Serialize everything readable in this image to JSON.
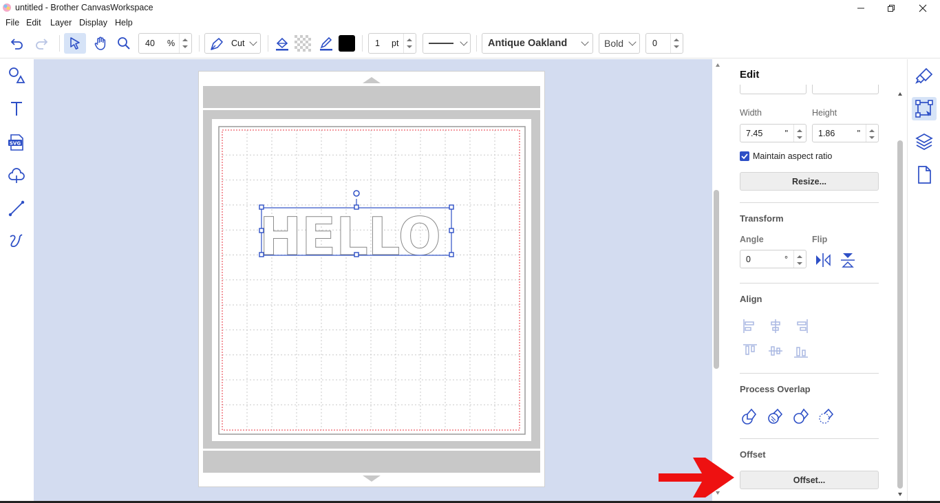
{
  "window": {
    "title": "untitled - Brother CanvasWorkspace"
  },
  "menu": [
    "File",
    "Edit",
    "Layer",
    "Display",
    "Help"
  ],
  "toolbar": {
    "zoom_value": "40",
    "zoom_unit": "%",
    "tool_mode": "Cut",
    "line_width": "1",
    "line_unit": "pt",
    "font_name": "Antique Oakland",
    "font_style": "Bold",
    "letter_spacing": "0",
    "stroke_color": "#000000"
  },
  "canvas": {
    "text": "HELLO"
  },
  "panel": {
    "title": "Edit",
    "width_label": "Width",
    "height_label": "Height",
    "width_value": "7.45",
    "height_value": "1.86",
    "size_unit": "\"",
    "aspect_label": "Maintain aspect ratio",
    "resize_button": "Resize...",
    "transform_title": "Transform",
    "angle_label": "Angle",
    "flip_label": "Flip",
    "angle_value": "0",
    "angle_unit": "°",
    "align_title": "Align",
    "overlap_title": "Process Overlap",
    "offset_title": "Offset",
    "offset_button": "Offset..."
  },
  "colors": {
    "accent": "#2d4fc6",
    "canvas_bg": "#d3dcf0",
    "callout_arrow": "#ee1111"
  }
}
